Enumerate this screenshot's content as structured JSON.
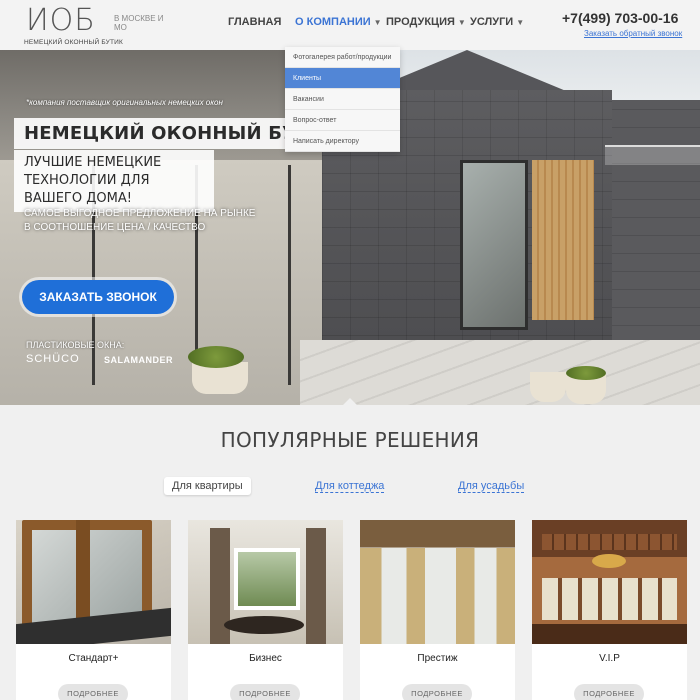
{
  "header": {
    "logo_mark": "ИОБ",
    "logo_subtitle": "НЕМЕЦКИЙ ОКОННЫЙ БУТИК",
    "city": "В МОСКВЕ И МО",
    "nav": [
      {
        "label": "ГЛАВНАЯ"
      },
      {
        "label": "О КОМПАНИИ",
        "active": true
      },
      {
        "label": "ПРОДУКЦИЯ"
      },
      {
        "label": "УСЛУГИ"
      }
    ],
    "phone": "+7(499) 703-00-16",
    "callback_link": "Заказать обратный звонок"
  },
  "dropdown": {
    "items": [
      {
        "label": "Фотогалерея работ/продукции"
      },
      {
        "label": "Клиенты",
        "active": true
      },
      {
        "label": "Вакансии"
      },
      {
        "label": "Вопрос-ответ"
      },
      {
        "label": "Написать директору"
      }
    ]
  },
  "hero": {
    "tagline": "*компания поставщик оригинальных немецких окон",
    "title": "НЕМЕЦКИЙ ОКОННЫЙ БУТИК",
    "subtitle": "ЛУЧШИЕ НЕМЕЦКИЕ ТЕХНОЛОГИИ ДЛЯ ВАШЕГО ДОМА!",
    "offer_line1": "САМОЕ ВЫГОДНОЕ ПРЕДЛОЖЕНИЕ НА РЫНКЕ",
    "offer_line2": "В СООТНОШЕНИЕ ЦЕНА / КАЧЕСТВО",
    "cta": "ЗАКАЗАТЬ ЗВОНОК",
    "brands_label": "ПЛАСТИКОВЫЕ ОКНА:",
    "brand1": "SCHÜCO",
    "brand2": "SALAMANDER"
  },
  "popular": {
    "title": "ПОПУЛЯРНЫЕ РЕШЕНИЯ",
    "tabs": [
      {
        "label": "Для квартиры",
        "selected": true
      },
      {
        "label": "Для коттеджа"
      },
      {
        "label": "Для усадьбы"
      }
    ],
    "cards": [
      {
        "name": "Стандарт+",
        "button": "ПОДРОБНЕЕ"
      },
      {
        "name": "Бизнес",
        "button": "ПОДРОБНЕЕ"
      },
      {
        "name": "Престиж",
        "button": "ПОДРОБНЕЕ"
      },
      {
        "name": "V.I.P",
        "button": "ПОДРОБНЕЕ"
      }
    ]
  },
  "colors": {
    "accent": "#3b74d4",
    "cta": "#1f6fd8",
    "dropdown_active": "#5286d6"
  }
}
